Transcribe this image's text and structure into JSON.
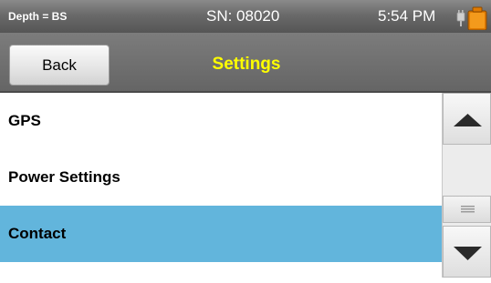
{
  "status_bar": {
    "depth_label": "Depth = BS",
    "serial": "SN: 08020",
    "time": "5:54 PM",
    "battery_icon": "battery-charging-icon"
  },
  "header": {
    "back_label": "Back",
    "title": "Settings",
    "title_color": "#ffff00"
  },
  "list": {
    "items": [
      {
        "label": "GPS",
        "selected": false
      },
      {
        "label": "Power Settings",
        "selected": false
      },
      {
        "label": "Contact",
        "selected": true
      }
    ],
    "selected_color": "#62b5dc"
  },
  "scrollbar": {
    "up_icon": "triangle-up-icon",
    "down_icon": "triangle-down-icon",
    "thumb_icon": "grip-lines-icon"
  }
}
